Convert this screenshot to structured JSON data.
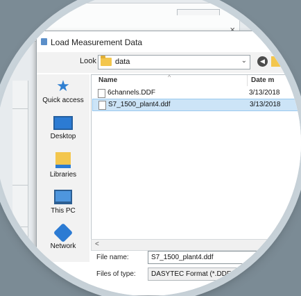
{
  "dialog": {
    "title": "Load Measurement Data",
    "close_glyph": "×"
  },
  "lookin": {
    "label": "Look in:",
    "value": "data",
    "caret": "⌄"
  },
  "places": {
    "items": [
      {
        "label": "Quick access",
        "icon": "star-icon"
      },
      {
        "label": "Desktop",
        "icon": "desktop-icon"
      },
      {
        "label": "Libraries",
        "icon": "libraries-icon"
      },
      {
        "label": "This PC",
        "icon": "computer-icon"
      },
      {
        "label": "Network",
        "icon": "network-icon"
      }
    ]
  },
  "filelist": {
    "columns": {
      "name": "Name",
      "date": "Date m"
    },
    "sort_caret": "^",
    "rows": [
      {
        "name": "6channels.DDF",
        "date": "3/13/2018",
        "selected": false
      },
      {
        "name": "S7_1500_plant4.ddf",
        "date": "3/13/2018",
        "selected": true
      }
    ],
    "scroll_left": "<"
  },
  "filename": {
    "label": "File name:",
    "value": "S7_1500_plant4.ddf"
  },
  "filetype": {
    "label": "Files of type:",
    "value": "DASYTEC Format (*.DDF"
  },
  "colors": {
    "selection": "#cce4f7",
    "accent": "#2c7bd3",
    "folder": "#f3c64d"
  }
}
